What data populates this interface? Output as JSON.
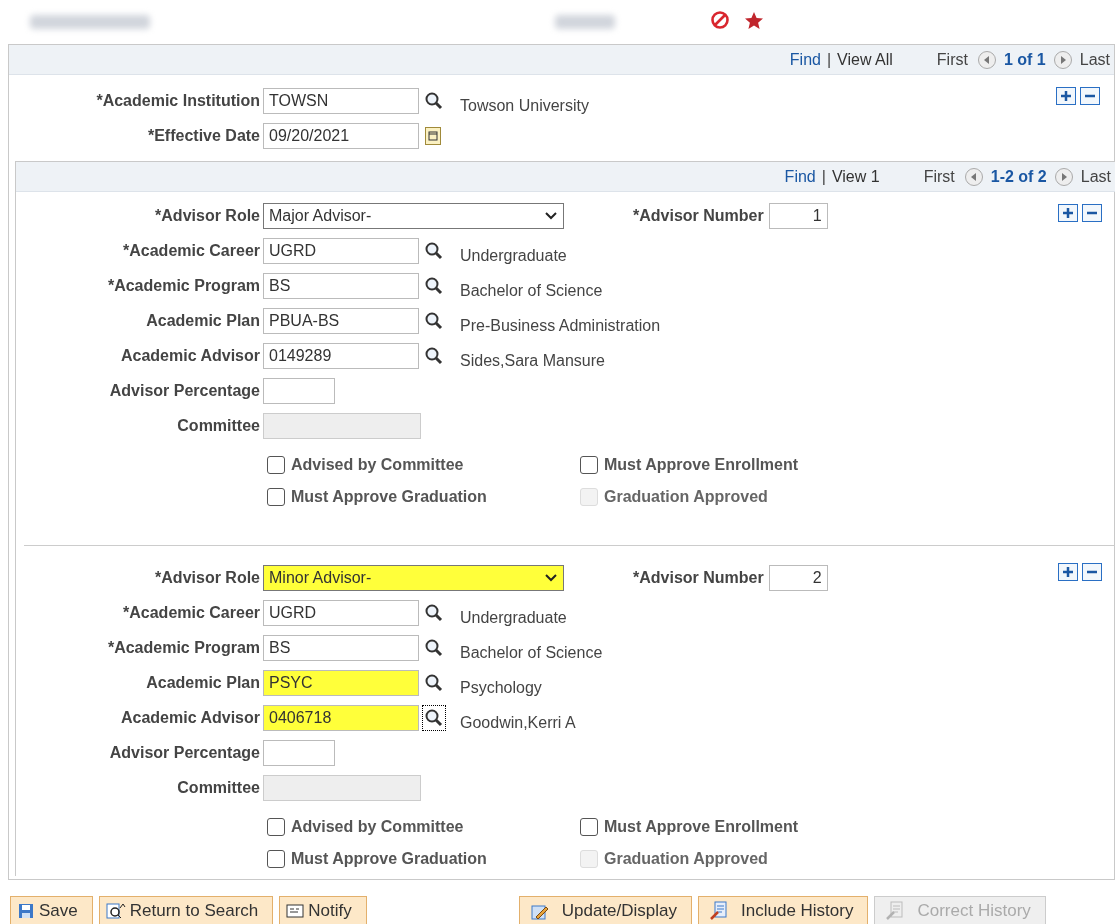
{
  "nav": {
    "links": [
      "Find",
      "View All"
    ],
    "separator": "|",
    "first": "First",
    "count": "1 of 1",
    "last": "Last"
  },
  "fields": [
    {
      "label": "*Academic Institution",
      "value": "TOWSN",
      "kind": "lookup",
      "description": "Towson University"
    },
    {
      "label": "*Effective Date",
      "value": "09/20/2021",
      "kind": "date"
    }
  ],
  "advisors": {
    "nav": {
      "links": [
        "Find",
        "View 1"
      ],
      "separator": "|",
      "first": "First",
      "count": "1-2 of 2",
      "last": "Last"
    },
    "rows": [
      {
        "role": {
          "label": "*Advisor Role",
          "value": "Major Advisor-",
          "highlighted": false
        },
        "number": {
          "label": "*Advisor Number",
          "value": "1"
        },
        "fields": [
          {
            "label": "*Academic Career",
            "value": "UGRD",
            "kind": "lookup",
            "description": "Undergraduate",
            "highlighted": false,
            "focused": false
          },
          {
            "label": "*Academic Program",
            "value": "BS",
            "kind": "lookup",
            "description": "Bachelor of Science",
            "highlighted": false,
            "focused": false
          },
          {
            "label": "Academic Plan",
            "value": "PBUA-BS",
            "kind": "lookup",
            "description": "Pre-Business Administration",
            "highlighted": false,
            "focused": false
          },
          {
            "label": "Academic Advisor",
            "value": "0149289",
            "kind": "lookup",
            "description": "Sides,Sara Mansure",
            "highlighted": false,
            "focused": false
          },
          {
            "label": "Advisor Percentage",
            "kind": "short"
          },
          {
            "label": "Committee",
            "kind": "disabled"
          }
        ],
        "checkboxes": [
          {
            "label": "Advised by Committee",
            "checked": false,
            "disabled": false
          },
          {
            "label": "Must Approve Enrollment",
            "checked": false,
            "disabled": false
          },
          {
            "label": "Must Approve Graduation",
            "checked": false,
            "disabled": false
          },
          {
            "label": "Graduation Approved",
            "checked": false,
            "disabled": true
          }
        ]
      },
      {
        "role": {
          "label": "*Advisor Role",
          "value": "Minor Advisor-",
          "highlighted": true
        },
        "number": {
          "label": "*Advisor Number",
          "value": "2"
        },
        "fields": [
          {
            "label": "*Academic Career",
            "value": "UGRD",
            "kind": "lookup",
            "description": "Undergraduate",
            "highlighted": false,
            "focused": false
          },
          {
            "label": "*Academic Program",
            "value": "BS",
            "kind": "lookup",
            "description": "Bachelor of Science",
            "highlighted": false,
            "focused": false
          },
          {
            "label": "Academic Plan",
            "value": "PSYC",
            "kind": "lookup",
            "description": "Psychology",
            "highlighted": true,
            "focused": false
          },
          {
            "label": "Academic Advisor",
            "value": "0406718",
            "kind": "lookup",
            "description": "Goodwin,Kerri A",
            "highlighted": true,
            "focused": true
          },
          {
            "label": "Advisor Percentage",
            "kind": "short"
          },
          {
            "label": "Committee",
            "kind": "disabled"
          }
        ],
        "checkboxes": [
          {
            "label": "Advised by Committee",
            "checked": false,
            "disabled": false
          },
          {
            "label": "Must Approve Enrollment",
            "checked": false,
            "disabled": false
          },
          {
            "label": "Must Approve Graduation",
            "checked": false,
            "disabled": false
          },
          {
            "label": "Graduation Approved",
            "checked": false,
            "disabled": true
          }
        ]
      }
    ]
  },
  "buttons": [
    {
      "label": "Save",
      "kind": "save",
      "disabled": false
    },
    {
      "label": "Return to Search",
      "kind": "search",
      "disabled": false
    },
    {
      "label": "Notify",
      "kind": "notify",
      "disabled": false
    },
    {
      "label": "Update/Display",
      "kind": "pencil",
      "disabled": false
    },
    {
      "label": "Include History",
      "kind": "history",
      "disabled": false
    },
    {
      "label": "Correct History",
      "kind": "history",
      "disabled": true
    }
  ]
}
